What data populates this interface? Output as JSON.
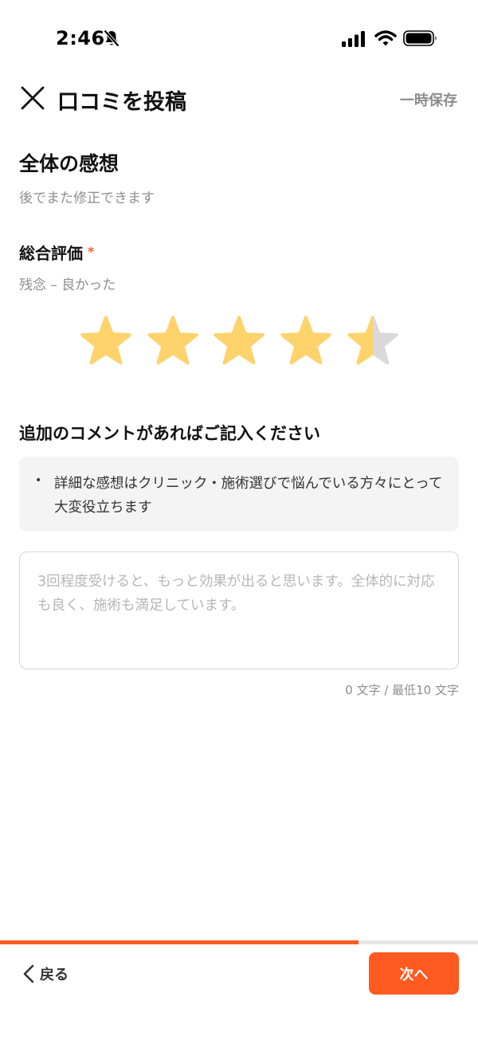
{
  "status_bar": {
    "time": "2:46",
    "icons": [
      "bell-slash-icon",
      "cellular-signal-icon",
      "wifi-icon",
      "battery-icon"
    ]
  },
  "header": {
    "close_icon": "close-icon",
    "title": "口コミを投稿",
    "save_draft_label": "一時保存"
  },
  "overall": {
    "title": "全体の感想",
    "subtitle": "後でまた修正できます"
  },
  "rating": {
    "label": "総合評価",
    "required_mark": "*",
    "scale_text": "残念 – 良かった",
    "value": 4.5,
    "max": 5,
    "star_color": "#ffd36b",
    "empty_star_color": "#d9d9d9"
  },
  "comment": {
    "label": "追加のコメントがあればご記入ください",
    "tip_bullet": "•",
    "tip": "詳細な感想はクリニック・施術選びで悩んでいる方々にとって大変役立ちます",
    "value": "",
    "placeholder": "3回程度受けると、もっと効果が出ると思います。全体的に対応も良く、施術も満足しています。",
    "char_count": "0 文字 / 最低10 文字"
  },
  "footer": {
    "progress": 0.75,
    "back_label": "戻る",
    "next_label": "次へ"
  },
  "colors": {
    "accent": "#ff5a1f",
    "muted_text": "#8e8e8e",
    "tip_background": "#f4f4f4"
  }
}
